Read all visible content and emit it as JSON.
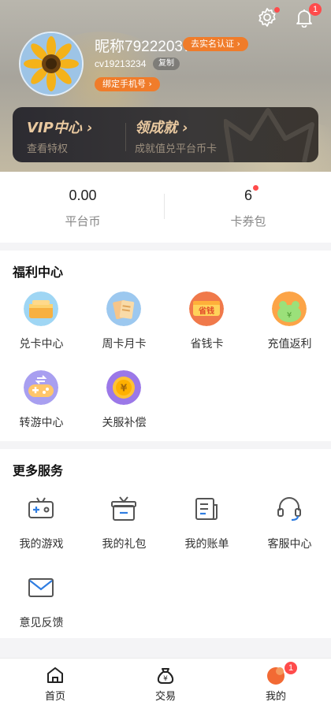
{
  "header": {
    "nickname": "昵称79222037",
    "verify_label": "去实名认证 ›",
    "uid": "cv19213234",
    "copy_label": "复制",
    "bind_phone_label": "绑定手机号 ›",
    "notification_count": "1"
  },
  "vip_card": {
    "vip_title": "VIP中心 ›",
    "vip_sub": "查看特权",
    "achieve_title": "领成就 ›",
    "achieve_sub": "成就值兑平台币卡"
  },
  "balance": {
    "coin_value": "0.00",
    "coin_label": "平台币",
    "coupon_value": "6",
    "coupon_label": "卡券包"
  },
  "welfare": {
    "title": "福利中心",
    "items": [
      {
        "label": "兑卡中心",
        "icon": "card-exchange-icon"
      },
      {
        "label": "周卡月卡",
        "icon": "weekly-card-icon"
      },
      {
        "label": "省钱卡",
        "icon": "savings-card-icon"
      },
      {
        "label": "充值返利",
        "icon": "recharge-rebate-icon"
      },
      {
        "label": "转游中心",
        "icon": "game-transfer-icon"
      },
      {
        "label": "关服补偿",
        "icon": "compensation-coin-icon"
      }
    ],
    "savings_card_text": "省钱"
  },
  "services": {
    "title": "更多服务",
    "items": [
      {
        "label": "我的游戏",
        "icon": "gamepad-icon"
      },
      {
        "label": "我的礼包",
        "icon": "gift-icon"
      },
      {
        "label": "我的账单",
        "icon": "bill-icon"
      },
      {
        "label": "客服中心",
        "icon": "headset-icon"
      },
      {
        "label": "意见反馈",
        "icon": "mail-icon"
      }
    ]
  },
  "tabbar": {
    "items": [
      {
        "label": "首页",
        "icon": "home-icon"
      },
      {
        "label": "交易",
        "icon": "money-bag-icon"
      },
      {
        "label": "我的",
        "icon": "profile-icon"
      }
    ],
    "profile_badge": "1"
  },
  "colors": {
    "accent": "#f07c2a",
    "badge": "#ff4b4b",
    "vip_gold": "#e9c9a0"
  }
}
